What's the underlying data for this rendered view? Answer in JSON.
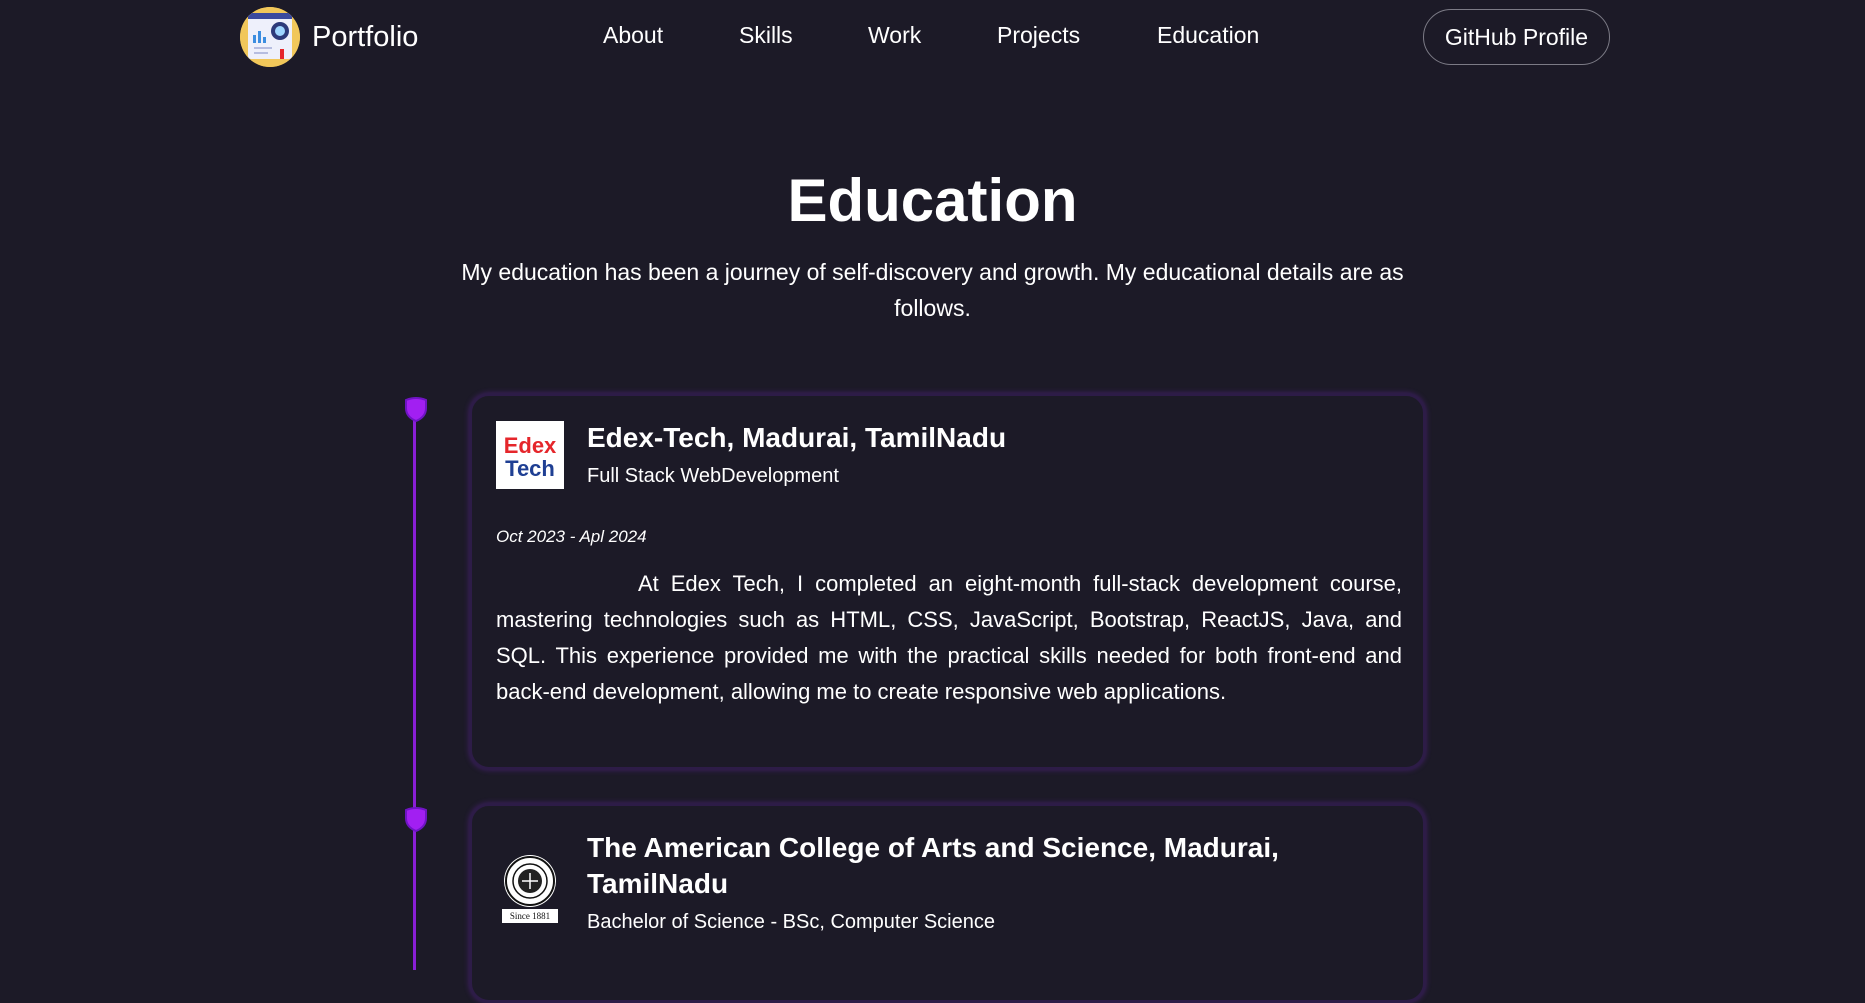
{
  "header": {
    "brand": "Portfolio",
    "nav": [
      {
        "label": "About"
      },
      {
        "label": "Skills"
      },
      {
        "label": "Work"
      },
      {
        "label": "Projects"
      },
      {
        "label": "Education"
      }
    ],
    "github_label": "GitHub Profile"
  },
  "section": {
    "title": "Education",
    "description": "My education has been a journey of self-discovery and growth. My educational details are as follows."
  },
  "education": [
    {
      "school": "Edex-Tech, Madurai, TamilNadu",
      "degree": "Full Stack WebDevelopment",
      "date": "Oct 2023 - Apl 2024",
      "description": "At Edex Tech, I completed an eight-month full-stack development course, mastering technologies such as HTML, CSS, JavaScript, Bootstrap, ReactJS, Java, and SQL. This experience provided me with the practical skills needed for both front-end and back-end development, allowing me to create responsive web applications.",
      "logo_text_top": "Edex",
      "logo_text_bottom": "Tech"
    },
    {
      "school": "The American College of Arts and Science, Madurai, TamilNadu",
      "degree": "Bachelor of Science - BSc, Computer Science",
      "logo_caption": "Since 1881"
    }
  ],
  "colors": {
    "background": "#1c1a27",
    "accent": "#8a1fd6",
    "card_border": "#2d1c47",
    "edex_red": "#e5262b",
    "edex_blue": "#1f3f93"
  }
}
